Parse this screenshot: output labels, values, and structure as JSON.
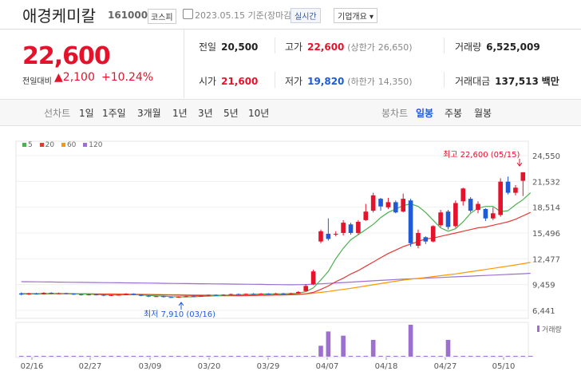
{
  "header": {
    "name": "애경케미칼",
    "code": "161000",
    "market": "코스피",
    "date": "2023.05.15 기준(장마감)",
    "realtime": "실시간",
    "corp_btn": "기업개요"
  },
  "price": {
    "current": "22,600",
    "change_label": "전일대비",
    "change": "2,100",
    "percent": "+10.24%"
  },
  "stats": {
    "prev_label": "전일",
    "prev": "20,500",
    "high_label": "고가",
    "high": "22,600",
    "upper_label": "(상한가",
    "upper": "26,650)",
    "volume_label": "거래량",
    "volume": "6,525,009",
    "open_label": "시가",
    "open": "21,600",
    "low_label": "저가",
    "low": "19,820",
    "lower_label": "(하한가",
    "lower": "14,350)",
    "amount_label": "거래대금",
    "amount": "137,513",
    "amount_unit": "백만"
  },
  "tabs": {
    "line_label": "선차트",
    "periods": [
      "1일",
      "1주일",
      "3개월",
      "1년",
      "3년",
      "5년",
      "10년"
    ],
    "candle_label": "봉차트",
    "candle_periods": [
      "일봉",
      "주봉",
      "월봉"
    ],
    "active_candle": "일봉"
  },
  "legend": [
    {
      "label": "5",
      "color": "#4caf50"
    },
    {
      "label": "20",
      "color": "#e53935"
    },
    {
      "label": "60",
      "color": "#ff9800"
    },
    {
      "label": "120",
      "color": "#9c6fd0"
    }
  ],
  "annotations": {
    "max": "최고 22,600 (05/15)",
    "min": "최저 7,910 (03/16)",
    "volume_legend": "거래량"
  },
  "chart_data": {
    "type": "candlestick",
    "y_ticks": [
      "24,550",
      "21,532",
      "18,514",
      "15,496",
      "12,477",
      "9,459",
      "6,441"
    ],
    "x_ticks": [
      "02/16",
      "02/27",
      "03/09",
      "03/20",
      "03/29",
      "04/07",
      "04/18",
      "04/27",
      "05/10"
    ],
    "ylim": [
      6441,
      24550
    ],
    "candles": [
      {
        "o": 8430,
        "c": 8300,
        "h": 8550,
        "l": 8200
      },
      {
        "o": 8300,
        "c": 8420,
        "h": 8500,
        "l": 8250
      },
      {
        "o": 8400,
        "c": 8350,
        "h": 8480,
        "l": 8280
      },
      {
        "o": 8350,
        "c": 8500,
        "h": 8560,
        "l": 8300
      },
      {
        "o": 8500,
        "c": 8400,
        "h": 8560,
        "l": 8350
      },
      {
        "o": 8400,
        "c": 8450,
        "h": 8520,
        "l": 8350
      },
      {
        "o": 8450,
        "c": 8380,
        "h": 8500,
        "l": 8320
      },
      {
        "o": 8380,
        "c": 8320,
        "h": 8420,
        "l": 8250
      },
      {
        "o": 8320,
        "c": 8250,
        "h": 8380,
        "l": 8180
      },
      {
        "o": 8250,
        "c": 8300,
        "h": 8350,
        "l": 8200
      },
      {
        "o": 8300,
        "c": 8260,
        "h": 8360,
        "l": 8200
      },
      {
        "o": 8260,
        "c": 8180,
        "h": 8300,
        "l": 8100
      },
      {
        "o": 8180,
        "c": 8230,
        "h": 8280,
        "l": 8120
      },
      {
        "o": 8230,
        "c": 8260,
        "h": 8320,
        "l": 8180
      },
      {
        "o": 8260,
        "c": 8400,
        "h": 8450,
        "l": 8220
      },
      {
        "o": 8400,
        "c": 8300,
        "h": 8430,
        "l": 8250
      },
      {
        "o": 8300,
        "c": 8150,
        "h": 8350,
        "l": 8100
      },
      {
        "o": 8150,
        "c": 8060,
        "h": 8200,
        "l": 8000
      },
      {
        "o": 8060,
        "c": 8100,
        "h": 8150,
        "l": 8000
      },
      {
        "o": 8100,
        "c": 8000,
        "h": 8150,
        "l": 7950
      },
      {
        "o": 8000,
        "c": 7960,
        "h": 8050,
        "l": 7910
      },
      {
        "o": 7960,
        "c": 8020,
        "h": 8080,
        "l": 7930
      },
      {
        "o": 8020,
        "c": 8100,
        "h": 8150,
        "l": 7980
      },
      {
        "o": 8100,
        "c": 8070,
        "h": 8180,
        "l": 8020
      },
      {
        "o": 8070,
        "c": 8150,
        "h": 8200,
        "l": 8040
      },
      {
        "o": 8150,
        "c": 8250,
        "h": 8290,
        "l": 8100
      },
      {
        "o": 8250,
        "c": 8200,
        "h": 8300,
        "l": 8150
      },
      {
        "o": 8200,
        "c": 8280,
        "h": 8330,
        "l": 8150
      },
      {
        "o": 8280,
        "c": 8350,
        "h": 8400,
        "l": 8230
      },
      {
        "o": 8350,
        "c": 8300,
        "h": 8420,
        "l": 8260
      },
      {
        "o": 8300,
        "c": 8380,
        "h": 8430,
        "l": 8260
      },
      {
        "o": 8380,
        "c": 8350,
        "h": 8450,
        "l": 8300
      },
      {
        "o": 8350,
        "c": 8400,
        "h": 8460,
        "l": 8300
      },
      {
        "o": 8400,
        "c": 8330,
        "h": 8450,
        "l": 8280
      },
      {
        "o": 8330,
        "c": 8420,
        "h": 8480,
        "l": 8290
      },
      {
        "o": 8420,
        "c": 8380,
        "h": 8480,
        "l": 8330
      },
      {
        "o": 8380,
        "c": 8450,
        "h": 8500,
        "l": 8330
      },
      {
        "o": 8450,
        "c": 8600,
        "h": 8700,
        "l": 8400
      },
      {
        "o": 8700,
        "c": 9300,
        "h": 9500,
        "l": 8650
      },
      {
        "o": 9500,
        "c": 11000,
        "h": 11200,
        "l": 9400
      },
      {
        "o": 14500,
        "c": 15700,
        "h": 15900,
        "l": 14300
      },
      {
        "o": 15400,
        "c": 14800,
        "h": 17200,
        "l": 14600
      },
      {
        "o": 15300,
        "c": 15400,
        "h": 15700,
        "l": 15100
      },
      {
        "o": 15500,
        "c": 16700,
        "h": 17000,
        "l": 15200
      },
      {
        "o": 16500,
        "c": 15500,
        "h": 16700,
        "l": 15300
      },
      {
        "o": 15500,
        "c": 16800,
        "h": 17000,
        "l": 15300
      },
      {
        "o": 17000,
        "c": 18000,
        "h": 18900,
        "l": 16900
      },
      {
        "o": 18100,
        "c": 19900,
        "h": 20200,
        "l": 17900
      },
      {
        "o": 19500,
        "c": 18600,
        "h": 19600,
        "l": 18100
      },
      {
        "o": 18500,
        "c": 19100,
        "h": 19600,
        "l": 18300
      },
      {
        "o": 19100,
        "c": 17900,
        "h": 19300,
        "l": 17800
      },
      {
        "o": 18000,
        "c": 19500,
        "h": 20100,
        "l": 17900
      },
      {
        "o": 19300,
        "c": 14300,
        "h": 19500,
        "l": 13900
      },
      {
        "o": 14000,
        "c": 15500,
        "h": 15900,
        "l": 13700
      },
      {
        "o": 15000,
        "c": 14500,
        "h": 15100,
        "l": 14200
      },
      {
        "o": 14500,
        "c": 16300,
        "h": 16400,
        "l": 14400
      },
      {
        "o": 16400,
        "c": 17900,
        "h": 18200,
        "l": 16200
      },
      {
        "o": 18000,
        "c": 16200,
        "h": 18200,
        "l": 15900
      },
      {
        "o": 16300,
        "c": 19000,
        "h": 19300,
        "l": 16100
      },
      {
        "o": 19200,
        "c": 20700,
        "h": 20800,
        "l": 18700
      },
      {
        "o": 19500,
        "c": 18100,
        "h": 19700,
        "l": 17900
      },
      {
        "o": 18200,
        "c": 18900,
        "h": 19200,
        "l": 17800
      },
      {
        "o": 18300,
        "c": 17200,
        "h": 18400,
        "l": 16900
      },
      {
        "o": 17200,
        "c": 17800,
        "h": 18500,
        "l": 17000
      },
      {
        "o": 17600,
        "c": 21500,
        "h": 21900,
        "l": 17400
      },
      {
        "o": 21500,
        "c": 20200,
        "h": 22100,
        "l": 20000
      },
      {
        "o": 20200,
        "c": 20800,
        "h": 21100,
        "l": 19900
      },
      {
        "o": 21600,
        "c": 22600,
        "h": 22600,
        "l": 19820
      }
    ],
    "ma5": [
      8380,
      8370,
      8370,
      8390,
      8400,
      8410,
      8410,
      8400,
      8370,
      8340,
      8300,
      8260,
      8240,
      8230,
      8260,
      8270,
      8250,
      8190,
      8140,
      8100,
      8050,
      8030,
      8020,
      8040,
      8070,
      8110,
      8150,
      8190,
      8240,
      8270,
      8300,
      8320,
      8350,
      8360,
      8370,
      8380,
      8400,
      8440,
      8630,
      9070,
      10000,
      11000,
      12500,
      13700,
      14700,
      15300,
      15900,
      16500,
      17300,
      17900,
      18300,
      18700,
      18900,
      18600,
      17900,
      17000,
      16100,
      15700,
      16000,
      16800,
      17800,
      18400,
      18600,
      18600,
      18000,
      18100,
      18800,
      19400,
      20200
    ],
    "ma20": [
      8350,
      8360,
      8360,
      8370,
      8370,
      8380,
      8380,
      8380,
      8370,
      8360,
      8350,
      8340,
      8330,
      8320,
      8320,
      8310,
      8300,
      8290,
      8270,
      8250,
      8230,
      8220,
      8200,
      8180,
      8170,
      8160,
      8150,
      8150,
      8150,
      8160,
      8170,
      8180,
      8200,
      8210,
      8230,
      8250,
      8270,
      8300,
      8380,
      8550,
      8900,
      9300,
      9800,
      10200,
      10700,
      11100,
      11600,
      12100,
      12600,
      13100,
      13500,
      13900,
      14200,
      14500,
      14800,
      14900,
      15100,
      15300,
      15500,
      15700,
      15900,
      16100,
      16200,
      16400,
      16600,
      16800,
      17100,
      17500,
      17900
    ],
    "ma60": [
      8420,
      8420,
      8420,
      8410,
      8410,
      8400,
      8400,
      8390,
      8390,
      8380,
      8370,
      8360,
      8360,
      8350,
      8340,
      8330,
      8320,
      8310,
      8300,
      8290,
      8280,
      8270,
      8260,
      8250,
      8250,
      8240,
      8240,
      8230,
      8230,
      8230,
      8240,
      8250,
      8260,
      8270,
      8280,
      8290,
      8300,
      8320,
      8370,
      8450,
      8550,
      8650,
      8780,
      8900,
      9030,
      9160,
      9300,
      9440,
      9580,
      9720,
      9860,
      9990,
      10090,
      10190,
      10290,
      10400,
      10500,
      10600,
      10710,
      10840,
      10970,
      11100,
      11230,
      11360,
      11490,
      11620,
      11760,
      11900,
      12050
    ],
    "ma120": [
      9800,
      9790,
      9780,
      9770,
      9760,
      9750,
      9740,
      9730,
      9720,
      9710,
      9700,
      9690,
      9680,
      9670,
      9660,
      9650,
      9640,
      9630,
      9620,
      9610,
      9600,
      9590,
      9580,
      9570,
      9560,
      9550,
      9540,
      9530,
      9520,
      9510,
      9500,
      9490,
      9480,
      9470,
      9460,
      9450,
      9440,
      9450,
      9470,
      9500,
      9550,
      9600,
      9650,
      9700,
      9750,
      9800,
      9850,
      9900,
      9950,
      10000,
      10050,
      10090,
      10130,
      10170,
      10210,
      10250,
      10290,
      10330,
      10370,
      10410,
      10450,
      10490,
      10530,
      10570,
      10610,
      10650,
      10690,
      10730,
      10780
    ],
    "volume": [
      0,
      0,
      0,
      0,
      0,
      0,
      0,
      0,
      0,
      0,
      0,
      0,
      0,
      0,
      0,
      0,
      0,
      0,
      0,
      0,
      0,
      0,
      0,
      0,
      0,
      0,
      0,
      0,
      0,
      0,
      0,
      0,
      0,
      0,
      0,
      0,
      0,
      0,
      0,
      0,
      13,
      30,
      0,
      25,
      0,
      0,
      0,
      20,
      0,
      0,
      0,
      0,
      38,
      0,
      0,
      0,
      0,
      20,
      0,
      0,
      0,
      0,
      0,
      0,
      0,
      0,
      0,
      0,
      0
    ]
  }
}
